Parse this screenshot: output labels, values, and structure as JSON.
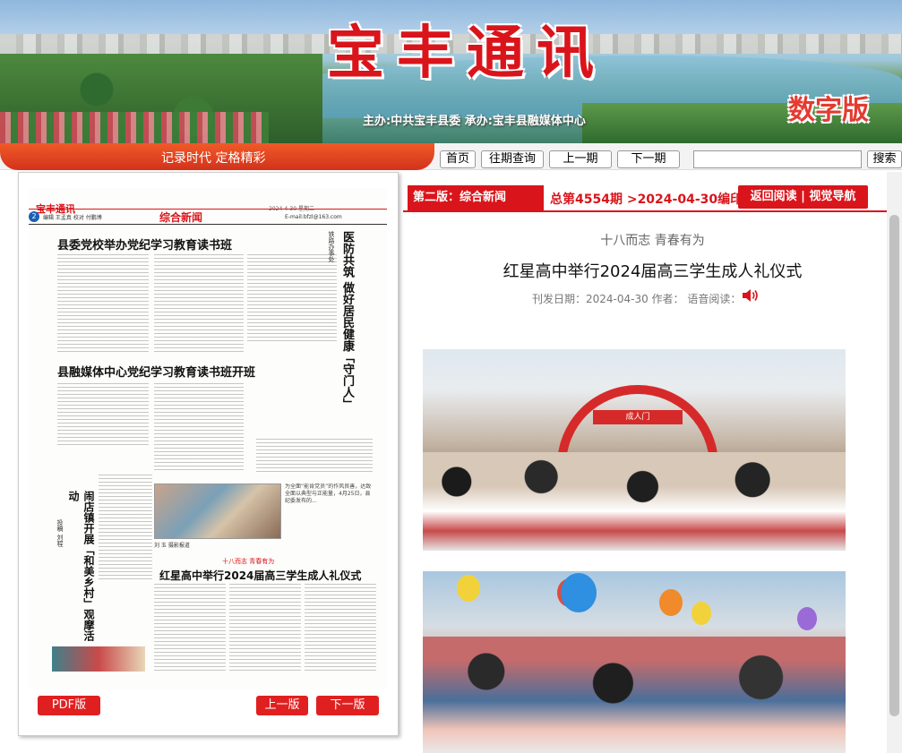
{
  "banner": {
    "title": "宝丰通讯",
    "digital_label": "数字版",
    "sponsor": "主办:中共宝丰县委   承办:宝丰县融媒体中心"
  },
  "nav": {
    "slogan": "记录时代  定格精彩",
    "home": "首页",
    "archive": "往期查询",
    "prev_issue": "上一期",
    "next_issue": "下一期",
    "search": "搜索"
  },
  "paper": {
    "masthead": "宝丰通讯",
    "date_line": "2024-4-30  星期二",
    "page_number": "2",
    "staff_line": "编辑 王孟真  校对 付鹏博",
    "section": "综合新闻",
    "contact": "E-mail:bfzl@163.com",
    "headline1": "县委党校举办党纪学习教育读书班",
    "headline2": "县融媒体中心党纪学习教育读书班开班",
    "vertical_kicker": "铁路办事处",
    "vertical_title": "医防共筑  做好居民健康「守门人」",
    "vertical_title2": "闹店镇开展「和美乡村」观摩活动",
    "vertical_byline": "投稿 刘程",
    "photo_caption": "刘 玉 摄影报道",
    "side_note": "为全面“能肯党员”的作风良善，达致全面以典型与正能量，4月25日，县纪委发布的...",
    "headline3_kicker": "十八而志  青春有为",
    "headline3": "红星高中举行2024届高三学生成人礼仪式",
    "pdf_button": "PDF版",
    "prev_page": "上一版",
    "next_page": "下一版"
  },
  "article": {
    "edition": "第二版：综合新闻",
    "issue_info": "总第4554期  >2024-04-30编印",
    "back_button": "返回阅读 | 视觉导航",
    "kicker": "十八而志  青春有为",
    "title": "红星高中举行2024届高三学生成人礼仪式",
    "meta": "刊发日期：2024-04-30  作者：    语音阅读：",
    "speaker_icon": "speaker-icon",
    "photo1_sign": "成人门"
  },
  "colors": {
    "brand_red": "#d9151b",
    "nav_orange": "#f05a28"
  }
}
